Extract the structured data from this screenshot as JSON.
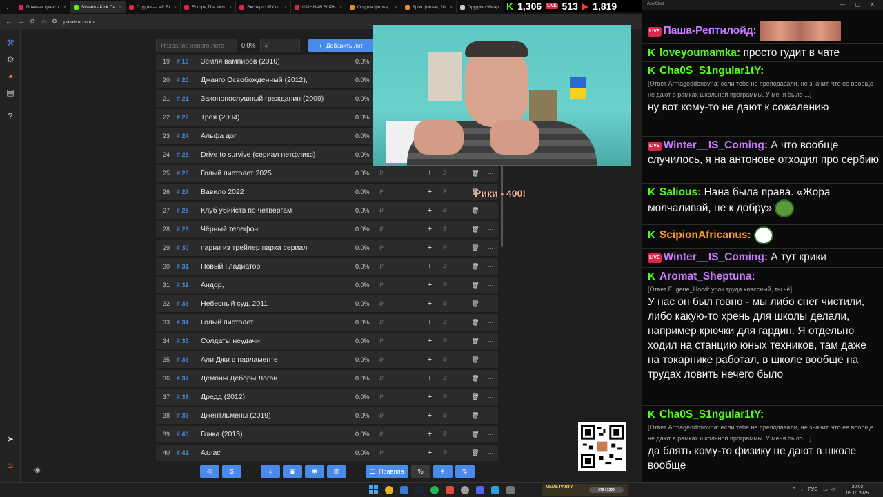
{
  "browser": {
    "tabs": [
      {
        "title": "Прямые трансл",
        "color": "#e0254b"
      },
      {
        "title": "Stream - Kick Da",
        "color": "#53fc18"
      },
      {
        "title": "Студия — VK Bi",
        "color": "#e0254b"
      },
      {
        "title": "Europe,The Mos",
        "color": "#e0254b"
      },
      {
        "title": "Эксперт ЦРУ о",
        "color": "#e0254b"
      },
      {
        "title": "ШИННАЯ БОРЬ",
        "color": "#e0254b"
      },
      {
        "title": "Орудия фильм,",
        "color": "#f08a24"
      },
      {
        "title": "Троя фильм, 20",
        "color": "#f08a24"
      },
      {
        "title": "Орудия / Weap",
        "color": "#cccccc"
      }
    ],
    "url": "pointauc.com"
  },
  "counters": {
    "kick": "1,306",
    "vk_live": "513",
    "youtube": "1,819"
  },
  "auction": {
    "new_lot_placeholder": "Название нового лота",
    "percent": "0.0%",
    "amount_placeholder": "₽",
    "add_button": "Добавить лот",
    "lots": [
      {
        "idx": "19",
        "num": "# 19",
        "name": "Земля вампиров (2010)",
        "pct": "0.0%"
      },
      {
        "idx": "20",
        "num": "# 20",
        "name": "Джанго Освобожденный (2012),",
        "pct": "0.0%"
      },
      {
        "idx": "21",
        "num": "# 21",
        "name": "Законопослушный гражданин (2009)",
        "pct": "0.0%"
      },
      {
        "idx": "22",
        "num": "# 22",
        "name": "Троя (2004)",
        "pct": "0.0%"
      },
      {
        "idx": "23",
        "num": "# 24",
        "name": "Альфа дог",
        "pct": "0.0%"
      },
      {
        "idx": "24",
        "num": "# 25",
        "name": "Drive to survive (сериал нетфликс)",
        "pct": "0.0%"
      },
      {
        "idx": "25",
        "num": "# 26",
        "name": "Голый пистолет 2025",
        "pct": "0.0%"
      },
      {
        "idx": "26",
        "num": "# 27",
        "name": "Вавило 2022",
        "pct": "0.0%"
      },
      {
        "idx": "27",
        "num": "# 28",
        "name": "Клуб убийств по четвергам",
        "pct": "0.0%"
      },
      {
        "idx": "28",
        "num": "# 29",
        "name": "Чёрный телефон",
        "pct": "0.0%"
      },
      {
        "idx": "29",
        "num": "# 30",
        "name": "парни из трейлер парка сериал",
        "pct": "0.0%"
      },
      {
        "idx": "30",
        "num": "# 31",
        "name": "Новый Гладиатор",
        "pct": "0.0%"
      },
      {
        "idx": "31",
        "num": "# 32",
        "name": "Андор,",
        "pct": "0.0%"
      },
      {
        "idx": "32",
        "num": "# 33",
        "name": "Небесный суд, 2011",
        "pct": "0.0%"
      },
      {
        "idx": "33",
        "num": "# 34",
        "name": "Голый пистолет",
        "pct": "0.0%"
      },
      {
        "idx": "34",
        "num": "# 35",
        "name": "Солдаты неудачи",
        "pct": "0.0%"
      },
      {
        "idx": "35",
        "num": "# 36",
        "name": "Али Джи в парламенте",
        "pct": "0.0%"
      },
      {
        "idx": "36",
        "num": "# 37",
        "name": "Демоны Деборы Логан",
        "pct": "0.0%"
      },
      {
        "idx": "37",
        "num": "# 38",
        "name": "Дредд (2012)",
        "pct": "0.0%"
      },
      {
        "idx": "38",
        "num": "# 39",
        "name": "Джентльмены (2019)",
        "pct": "0.0%"
      },
      {
        "idx": "39",
        "num": "# 40",
        "name": "Гонка (2013)",
        "pct": "0.0%"
      },
      {
        "idx": "40",
        "num": "# 41",
        "name": "Атлас",
        "pct": "0.0%"
      }
    ],
    "currency": "₽",
    "plus": "+",
    "trash": "🗑",
    "more": "···",
    "rules_button": "Правила",
    "percent_button": "%",
    "overlay_text": "Рики - 400!"
  },
  "chat": {
    "window_title": "AxelChat",
    "messages": [
      {
        "badge": "live",
        "user": "Паша-Рептилойд:",
        "color": "#c97bff",
        "reply": "",
        "text": ""
      },
      {
        "badge": "kick",
        "user": "loveyoumamka:",
        "color": "#53fc18",
        "reply": "",
        "text": "просто гудит в чате"
      },
      {
        "badge": "kick",
        "user": "Cha0S_S1ngular1tY:",
        "color": "#53fc18",
        "reply": "[Ответ Armageddonovna: если тебе не преподавали, не значит, что ее вообще не дают в рамках школьной программы. У меня было ...]",
        "text": "ну вот кому-то не дают к сожалению"
      },
      {
        "badge": "live",
        "user": "Winter__IS_Coming:",
        "color": "#c97bff",
        "reply": "",
        "text": "А что вообще случилось, я на антонове отходил про сербию"
      },
      {
        "badge": "kick",
        "user": "Salious:",
        "color": "#53fc18",
        "reply": "",
        "text": "Нана была права. «Жора молчаливай, не к добру»"
      },
      {
        "badge": "kick",
        "user": "ScipionAfricanus:",
        "color": "#ff9d2e",
        "reply": "",
        "text": ""
      },
      {
        "badge": "live",
        "user": "Winter__IS_Coming:",
        "color": "#c97bff",
        "reply": "",
        "text": "А тут крики"
      },
      {
        "badge": "kick",
        "user": "Aromat_Sheptuna:",
        "color": "#c97bff",
        "reply": "[Ответ Eugene_Hood: урок труда классный, ты чё]",
        "text": "У нас он был говно - мы либо снег чистили, либо какую-то хрень для школы делали, например крючки для гардин. Я отдельно ходил на станцию юных техников, там даже на токарнике работал, в школе вообще на трудах ловить нечего было"
      },
      {
        "badge": "kick",
        "user": "Cha0S_S1ngular1tY:",
        "color": "#53fc18",
        "reply": "[Ответ Armageddonovna: если тебе не преподавали, не значит, что ее вообще не дают в рамках школьной программы. У меня было ...]",
        "text": "да блять кому-то физику не дают в школе вообще"
      }
    ]
  },
  "taskbar": {
    "meme_label": "MEME PARTY",
    "meme_progress": "976 / 1500",
    "lang": "РУС",
    "time": "20:03",
    "date": "05.10.2025"
  }
}
